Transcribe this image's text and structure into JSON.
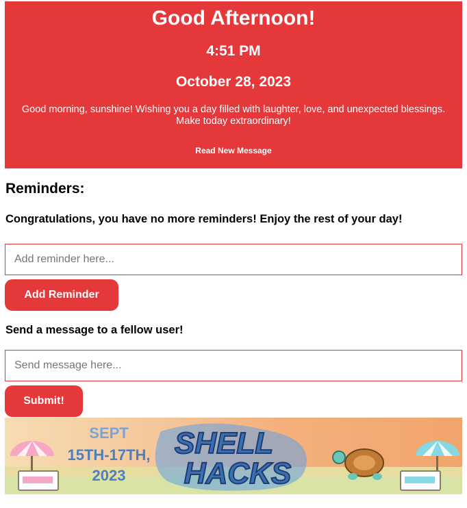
{
  "header": {
    "greeting": "Good Afternoon!",
    "time": "4:51 PM",
    "date": "October 28, 2023",
    "message": "Good morning, sunshine! Wishing you a day filled with laughter, love, and unexpected blessings. Make today extraordinary!",
    "read_new_label": "Read New Message"
  },
  "reminders": {
    "heading": "Reminders:",
    "empty_text": "Congratulations, you have no more reminders! Enjoy the rest of your day!",
    "input_placeholder": "Add reminder here...",
    "add_button_label": "Add Reminder"
  },
  "messaging": {
    "label": "Send a message to a fellow user!",
    "input_placeholder": "Send message here...",
    "submit_label": "Submit!"
  },
  "banner": {
    "date_line1": "SEPT",
    "date_line2": "15TH-17TH,",
    "date_line3": "2023",
    "logo_line1": "SHELL",
    "logo_line2": "HACKS",
    "colors": {
      "accent": "#e5383b",
      "logo": "#3b6fb3",
      "date_text": "#7aa4d6"
    }
  }
}
